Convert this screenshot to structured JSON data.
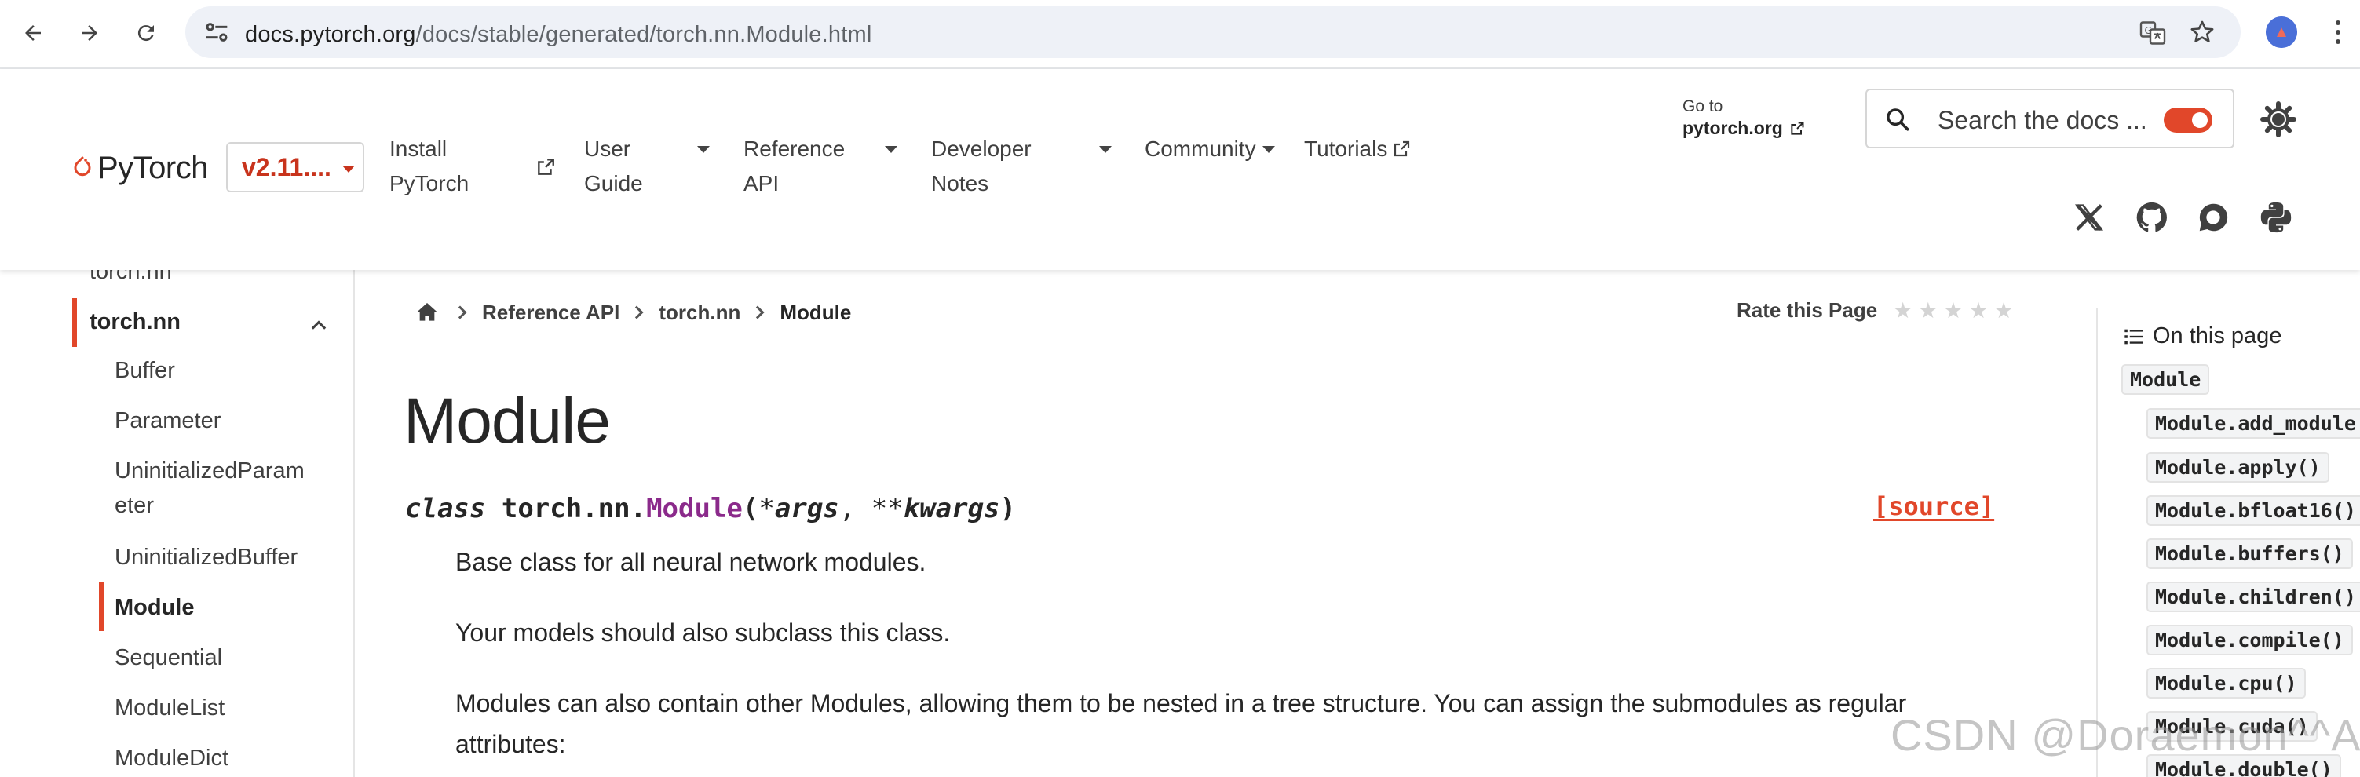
{
  "browser": {
    "url_host": "docs.pytorch.org",
    "url_path": "/docs/stable/generated/torch.nn.Module.html"
  },
  "header": {
    "logo_text": "PyTorch",
    "version": "v2.11....",
    "nav": {
      "install_line1": "Install",
      "install_line2": "PyTorch",
      "user_guide_line1": "User",
      "user_guide_line2": "Guide",
      "reference_line1": "Reference",
      "reference_line2": "API",
      "developer_line1": "Developer",
      "developer_line2": "Notes",
      "community": "Community",
      "tutorials": "Tutorials"
    },
    "goto_small": "Go to",
    "goto_link": "pytorch.org",
    "search_placeholder": "Search the docs ...",
    "accent": "#e1472a"
  },
  "sidebar": {
    "items": [
      {
        "label": "torch.nn"
      },
      {
        "label": "torch.nn"
      },
      {
        "label": "Buffer"
      },
      {
        "label": "Parameter"
      },
      {
        "label": "UninitializedParam"
      },
      {
        "label": "eter"
      },
      {
        "label": "UninitializedBuffer"
      },
      {
        "label": "Module"
      },
      {
        "label": "Sequential"
      },
      {
        "label": "ModuleList"
      },
      {
        "label": "ModuleDict"
      }
    ]
  },
  "breadcrumb": {
    "items": [
      "Reference API",
      "torch.nn",
      "Module"
    ]
  },
  "rate": {
    "label": "Rate this Page",
    "stars": 5
  },
  "content": {
    "title": "Module",
    "sig_class": "class",
    "sig_prefix": "torch.nn.",
    "sig_name": "Module",
    "sig_open": "(",
    "sig_star1": "*",
    "sig_args": "args",
    "sig_comma": ",",
    "sig_star2": "**",
    "sig_kwargs": "kwargs",
    "sig_close": ")",
    "source_label": "[source]",
    "para1": "Base class for all neural network modules.",
    "para2": "Your models should also subclass this class.",
    "para3_line1": "Modules can also contain other Modules, allowing them to be nested in a tree structure. You can assign the submodules as regular",
    "para3_line2": "attributes:"
  },
  "toc": {
    "heading": "On this page",
    "items": [
      "Module",
      "Module.add_module",
      "Module.apply()",
      "Module.bfloat16()",
      "Module.buffers()",
      "Module.children()",
      "Module.compile()",
      "Module.cpu()",
      "Module.cuda()",
      "Module.double()"
    ]
  },
  "watermark": "CSDN @Doraemon^^A"
}
